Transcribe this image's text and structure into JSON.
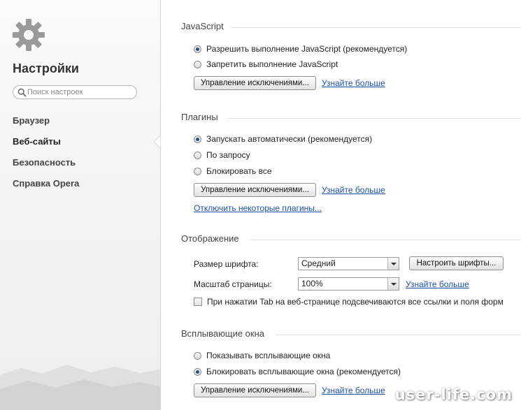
{
  "sidebar": {
    "title": "Настройки",
    "search_placeholder": "Поиск настроек",
    "items": [
      {
        "label": "Браузер"
      },
      {
        "label": "Веб-сайты"
      },
      {
        "label": "Безопасность"
      },
      {
        "label": "Справка Opera"
      }
    ],
    "active_item": "Веб-сайты"
  },
  "javascript": {
    "title": "JavaScript",
    "options": [
      {
        "label": "Разрешить выполнение JavaScript (рекомендуется)",
        "selected": true
      },
      {
        "label": "Запретить выполнение JavaScript",
        "selected": false
      }
    ],
    "manage_button": "Управление исключениями...",
    "learn_more": "Узнайте больше"
  },
  "plugins": {
    "title": "Плагины",
    "options": [
      {
        "label": "Запускать автоматически (рекомендуется)",
        "selected": true
      },
      {
        "label": "По запросу",
        "selected": false
      },
      {
        "label": "Блокировать все",
        "selected": false
      }
    ],
    "manage_button": "Управление исключениями...",
    "learn_more": "Узнайте больше",
    "disable_link": "Отключить некоторые плагины..."
  },
  "display": {
    "title": "Отображение",
    "font_size_label": "Размер шрифта:",
    "font_size_value": "Средний",
    "configure_fonts_button": "Настроить шрифты...",
    "zoom_label": "Масштаб страницы:",
    "zoom_value": "100%",
    "learn_more": "Узнайте больше",
    "tab_highlight_label": "При нажатии Tab на веб-странице подсвечиваются все ссылки и поля форм",
    "tab_highlight_checked": false
  },
  "popups": {
    "title": "Всплывающие окна",
    "options": [
      {
        "label": "Показывать всплывающие окна",
        "selected": false
      },
      {
        "label": "Блокировать всплывающие окна (рекомендуется)",
        "selected": true
      }
    ],
    "manage_button": "Управление исключениями...",
    "learn_more": "Узнайте больше"
  },
  "watermark": "user-life.com",
  "colors": {
    "link": "#1c50a8",
    "radio_selected": "#2a4f86",
    "sidebar_bg": "#f3f3f3"
  }
}
